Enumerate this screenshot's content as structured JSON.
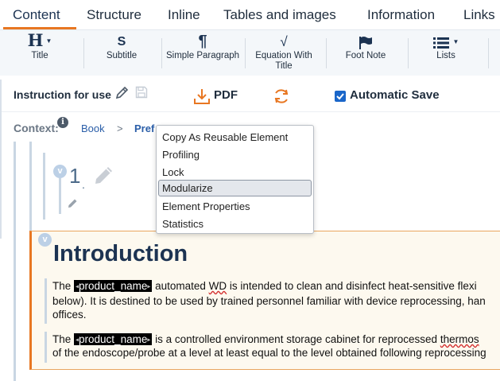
{
  "tabs": [
    {
      "label": "Content",
      "active": true
    },
    {
      "label": "Structure"
    },
    {
      "label": "Inline"
    },
    {
      "label": "Tables and images"
    },
    {
      "label": "Information"
    },
    {
      "label": "Links"
    }
  ],
  "ribbon": [
    {
      "label": "Title",
      "icon": "heading-icon",
      "glyph": "H"
    },
    {
      "label": "Subtitle",
      "icon": "subtitle-icon",
      "glyph": "S"
    },
    {
      "label": "Simple Paragraph",
      "icon": "pilcrow-icon",
      "glyph": "¶"
    },
    {
      "label": "Equation With Title",
      "icon": "sqrt-icon",
      "glyph": "√"
    },
    {
      "label": "Foot Note",
      "icon": "flag-icon"
    },
    {
      "label": "Lists",
      "icon": "list-icon"
    }
  ],
  "actionbar": {
    "instruction_label": "Instruction for use",
    "pdf_label": "PDF",
    "autosave_label": "Automatic Save",
    "autosave_checked": true
  },
  "context": {
    "label": "Context:",
    "info_glyph": "i",
    "crumbs": [
      "Book",
      "Pref"
    ],
    "separator": ">"
  },
  "section": {
    "number": "1",
    "dot": ".",
    "collapse_glyph": "v"
  },
  "menu": {
    "items": [
      {
        "label": "Copy As Reusable Element"
      },
      {
        "label": "Profiling"
      },
      {
        "label": "Lock"
      },
      {
        "label": "Modularize",
        "highlighted": true
      },
      {
        "label": "Element Properties"
      },
      {
        "label": "Statistics"
      }
    ]
  },
  "content": {
    "title": "Introduction",
    "para1": {
      "pre": "The ",
      "tag": "product_name",
      "mid": " automated ",
      "wd": "WD",
      "post": " is intended to clean and disinfect heat-sensitive flexi",
      "line2": "below). It is destined to be used by trained personnel familiar with device reprocessing, han",
      "line3": "offices."
    },
    "para2": {
      "pre": "The ",
      "tag": "product_name",
      "post": " is a controlled environment storage cabinet for reprocessed ",
      "thermo": "thermos",
      "line2": "of the endoscope/probe at a level at least equal to the level obtained following reprocessing"
    }
  },
  "colors": {
    "accent": "#e87722",
    "navy": "#1c3352",
    "link": "#2a5ea8",
    "checkbox": "#1a66c9"
  }
}
